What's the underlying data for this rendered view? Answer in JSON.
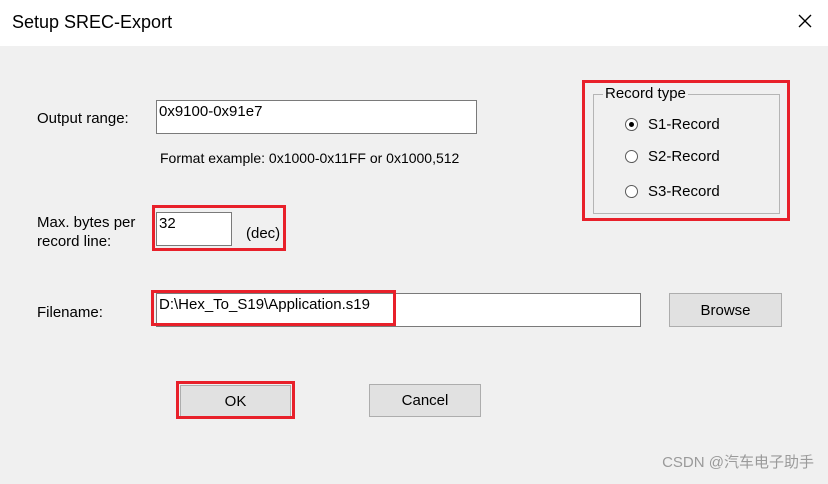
{
  "window": {
    "title": "Setup SREC-Export",
    "close_glyph": "✕"
  },
  "output_range": {
    "label": "Output range:",
    "value": "0x9100-0x91e7",
    "hint": "Format example: 0x1000-0x11FF or 0x1000,512"
  },
  "max_bytes": {
    "label_line1": "Max. bytes per",
    "label_line2": "record line:",
    "value": "32",
    "unit": "(dec)"
  },
  "record_type": {
    "legend": "Record type",
    "options": [
      {
        "label": "S1-Record",
        "checked": true
      },
      {
        "label": "S2-Record",
        "checked": false
      },
      {
        "label": "S3-Record",
        "checked": false
      }
    ]
  },
  "filename": {
    "label": "Filename:",
    "value": "D:\\Hex_To_S19\\Application.s19",
    "browse_label": "Browse"
  },
  "buttons": {
    "ok_label": "OK",
    "cancel_label": "Cancel"
  },
  "watermark": "CSDN @汽车电子助手",
  "highlight_color": "#e8202a"
}
